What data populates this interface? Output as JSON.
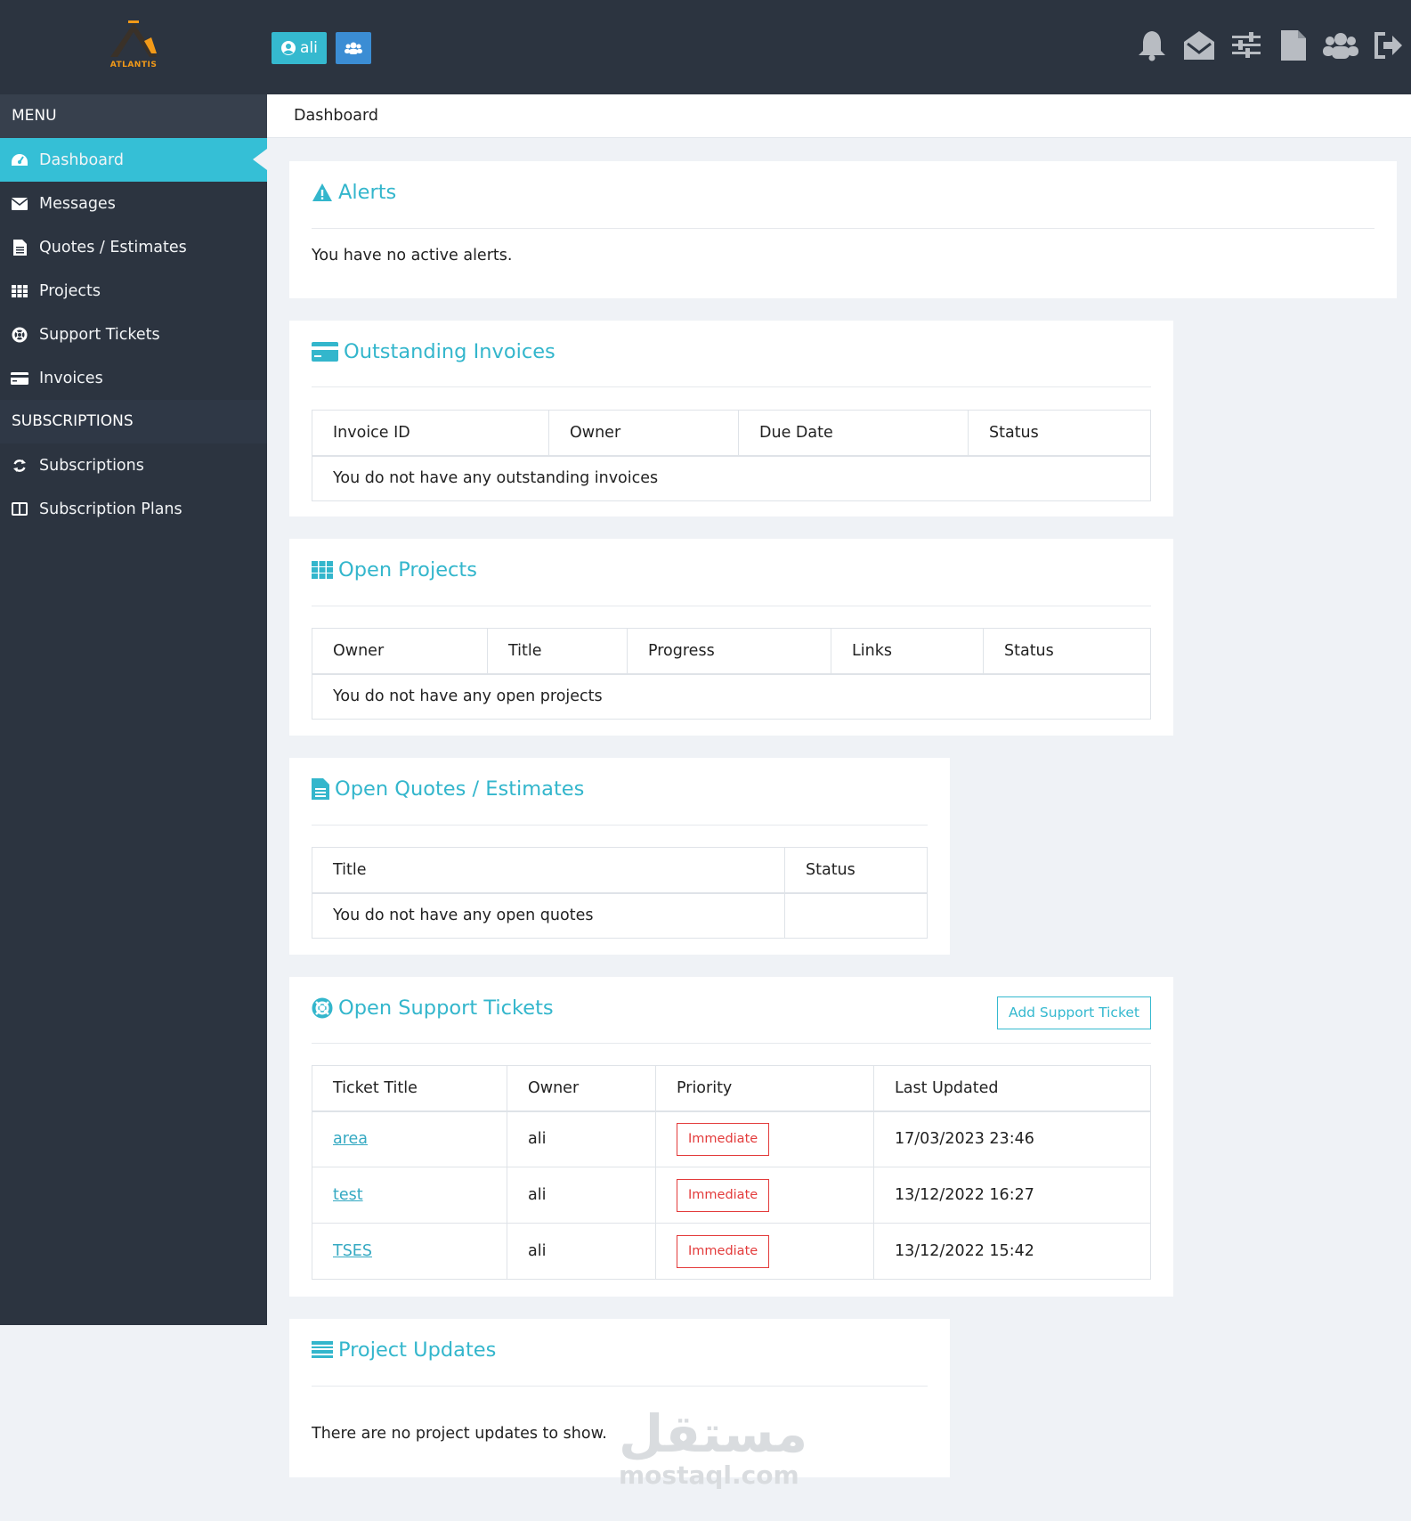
{
  "header": {
    "logo_text": "ATLANTIS",
    "user_label": "ali",
    "icons": [
      "bell-icon",
      "envelope-open-icon",
      "sliders-icon",
      "file-icon",
      "users-icon",
      "sign-out-icon"
    ]
  },
  "sidebar": {
    "menu_heading": "MENU",
    "items": [
      {
        "label": "Dashboard",
        "icon": "dashboard-icon",
        "active": true
      },
      {
        "label": "Messages",
        "icon": "envelope-icon"
      },
      {
        "label": "Quotes / Estimates",
        "icon": "file-text-icon"
      },
      {
        "label": "Projects",
        "icon": "grid-icon"
      },
      {
        "label": "Support Tickets",
        "icon": "life-ring-icon"
      },
      {
        "label": "Invoices",
        "icon": "credit-card-icon"
      }
    ],
    "subscriptions_heading": "SUBSCRIPTIONS",
    "sub_items": [
      {
        "label": "Subscriptions",
        "icon": "refresh-icon"
      },
      {
        "label": "Subscription Plans",
        "icon": "columns-icon"
      }
    ]
  },
  "breadcrumb": "Dashboard",
  "alerts": {
    "title": "Alerts",
    "text": "You have no active alerts."
  },
  "invoices": {
    "title": "Outstanding Invoices",
    "columns": [
      "Invoice ID",
      "Owner",
      "Due Date",
      "Status"
    ],
    "empty": "You do not have any outstanding invoices"
  },
  "projects": {
    "title": "Open Projects",
    "columns": [
      "Owner",
      "Title",
      "Progress",
      "Links",
      "Status"
    ],
    "empty": "You do not have any open projects"
  },
  "quotes": {
    "title": "Open Quotes / Estimates",
    "columns": [
      "Title",
      "Status"
    ],
    "empty": "You do not have any open quotes"
  },
  "tickets": {
    "title": "Open Support Tickets",
    "add_button": "Add Support Ticket",
    "columns": [
      "Ticket Title",
      "Owner",
      "Priority",
      "Last Updated"
    ],
    "rows": [
      {
        "title": "area",
        "owner": "ali",
        "priority": "Immediate",
        "updated": "17/03/2023 23:46"
      },
      {
        "title": "test",
        "owner": "ali",
        "priority": "Immediate",
        "updated": "13/12/2022 16:27"
      },
      {
        "title": "TSES",
        "owner": "ali",
        "priority": "Immediate",
        "updated": "13/12/2022 15:42"
      }
    ]
  },
  "updates": {
    "title": "Project Updates",
    "text": "There are no project updates to show."
  },
  "watermark": {
    "arabic": "مستقل",
    "latin": "mostaql.com"
  },
  "colors": {
    "accent": "#35bfd6",
    "sidebar": "#2c3440",
    "danger": "#e33b3b",
    "link": "#35a9c2"
  }
}
